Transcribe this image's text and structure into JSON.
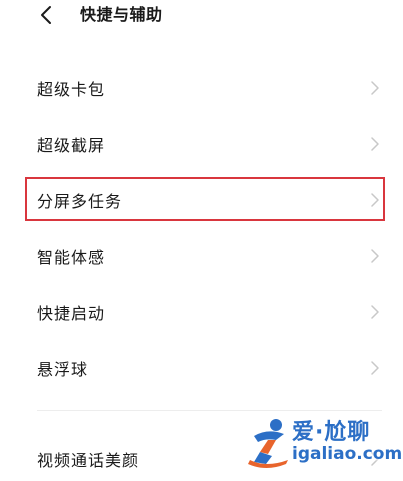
{
  "header": {
    "title": "快捷与辅助",
    "back_icon": "chevron-left-icon"
  },
  "list": {
    "items": [
      {
        "label": "超级卡包"
      },
      {
        "label": "超级截屏"
      },
      {
        "label": "分屏多任务"
      },
      {
        "label": "智能体感"
      },
      {
        "label": "快捷启动"
      },
      {
        "label": "悬浮球"
      }
    ],
    "last_item": {
      "label": "视频通话美颜"
    }
  },
  "highlight": {
    "color": "#d9363e",
    "target": "分屏多任务"
  },
  "watermark": {
    "line1": "爱·尬聊",
    "line2": "igaliao.com",
    "color": "#2c6fc6"
  },
  "colors": {
    "text": "#1a1a1a",
    "chevron": "#c8c8c8",
    "background": "#ffffff"
  }
}
